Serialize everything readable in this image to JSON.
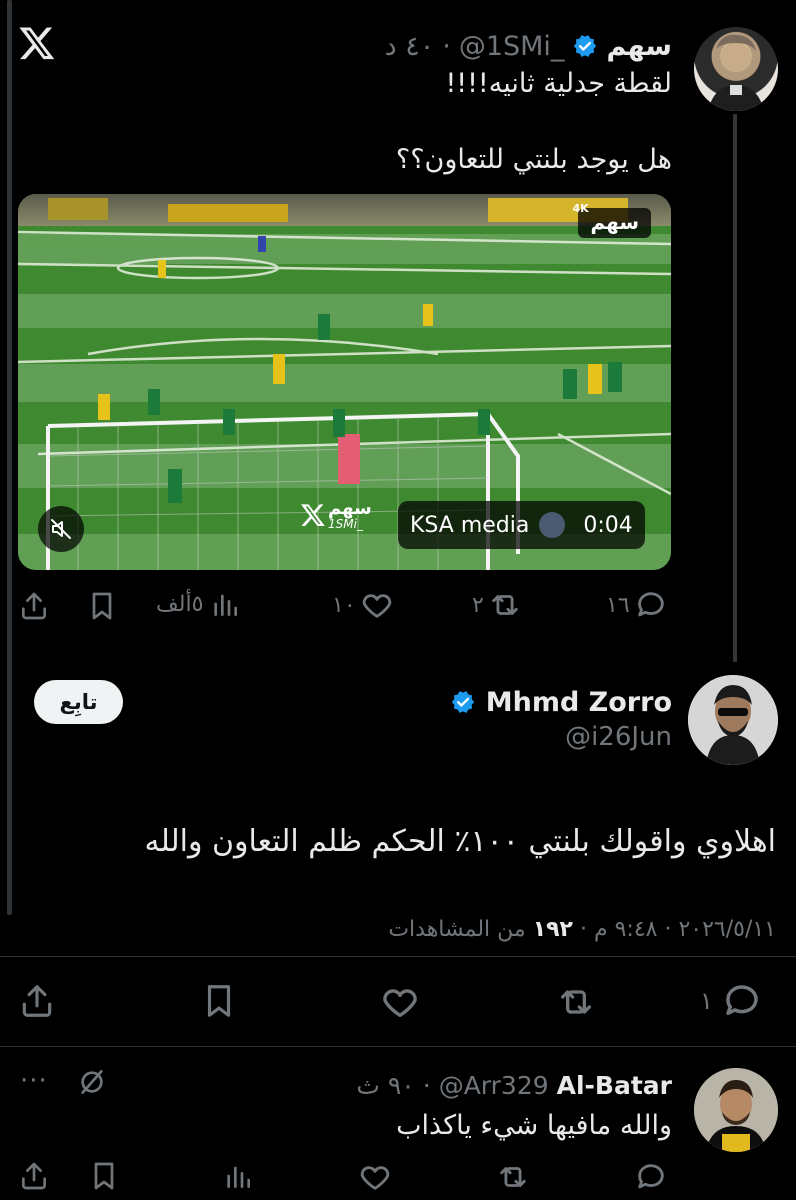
{
  "quoted_tweet": {
    "author_name": "سهم",
    "handle": "@1SMi_",
    "time": "٤٠ د",
    "text_line1": "لقطة جدلية ثانيه!!!!",
    "text_line2": "هل يوجد بلنتي للتعاون؟؟",
    "video": {
      "badge_4k": "4K",
      "badge_brand": "سهم",
      "watermark": "سهم",
      "watermark_sub": "1SMi_",
      "source_label": "KSA media",
      "duration": "0:04"
    },
    "actions": {
      "replies": "١٦",
      "reposts": "٢",
      "likes": "١٠",
      "views": "٥ألف"
    }
  },
  "main_tweet": {
    "author_name": "Mhmd Zorro",
    "handle": "@i26Jun",
    "follow_label": "تابِع",
    "text": "اهلاوي واقولك بلنتي ١٠٠٪ الحكم ظلم التعاون والله",
    "meta_datetime": "٢٠٢٦/٥/١١ · ٩:٤٨ م · ",
    "meta_views_count": "١٩٢",
    "meta_views_label": "من المشاهدات",
    "actions": {
      "replies": "١"
    }
  },
  "reply_tweet": {
    "author_name": "Al-Batar",
    "handle": "@Arr329",
    "time": "٩٠ ث",
    "more": "···",
    "text": "والله مافيها شيء ياكذاب"
  },
  "colors": {
    "background": "#000000",
    "text": "#e7e9ea",
    "muted": "#71767b",
    "verified": "#1d9bf0",
    "pitch": "#3f8a2f",
    "thread_line": "#333639"
  }
}
